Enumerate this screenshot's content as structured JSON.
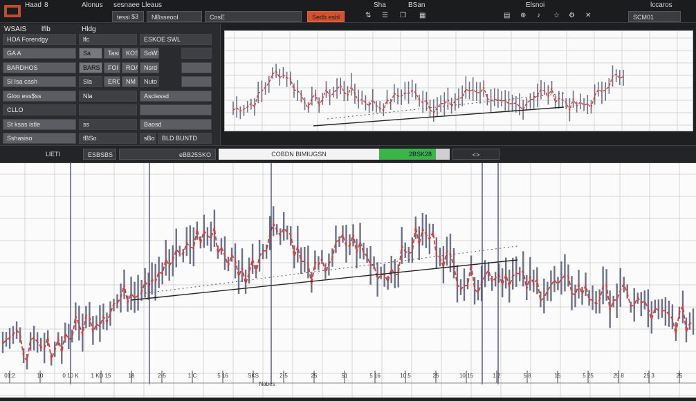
{
  "topbar": {
    "title": "Haad",
    "title_num": "8",
    "menu1": "Alonus",
    "menu2": "sesnaee Lleaus",
    "tab1": "tessi",
    "tab2": "$3",
    "tab3": "NBsseool",
    "tab4": "CosE",
    "alert_tab": "Sedb esbl",
    "right1": "Sha",
    "right2": "BSan",
    "right3": "Elsnoi",
    "right4": "SCM01",
    "far_right": "lccaros"
  },
  "panel": {
    "header_left": "WSAIS",
    "header_mid": "lflb",
    "header_right": "Hldg",
    "rows": [
      {
        "label": "HOA Forendgy",
        "c1": "lfc",
        "c2": "ESKOE SWL"
      },
      {
        "label": "GA A",
        "c1": "Sa",
        "c2": "Tasi",
        "c3": "KOS",
        "c4": "SoWSt"
      },
      {
        "label": "BARDHOS",
        "c1": "BARS",
        "c2": "FOI",
        "c3": "ROA",
        "c4": "Nsrd"
      },
      {
        "label": "Sl Isa cash",
        "c1": "Sla",
        "c2": "ERO",
        "c3": "NM",
        "c4": "Nuto"
      },
      {
        "label": "Gloo ess$ss",
        "c1": "Nla",
        "c2": "Asclassd"
      },
      {
        "label": "CLLO",
        "c1": "",
        "c2": ""
      },
      {
        "label": "St ksas istle",
        "c1": "ss",
        "c2": "Baosd"
      },
      {
        "label": "Sshasiso",
        "c1": "fBSo",
        "c2": "sBo",
        "c3": "BLD BUNTD"
      }
    ]
  },
  "statusbar": {
    "label": "LlETI",
    "field1": "ESBSBS",
    "field2": "eBB25SKO",
    "center": "COBDN BIMIUGSN",
    "green": "2BSK28",
    "nav": "<>"
  },
  "main_chart": {
    "x_label": "Nabes",
    "x_ticks": [
      "01:2",
      "10",
      "0 10 K",
      "1 KD 15",
      "18",
      "2-5",
      "1 C",
      "5 16",
      "SKS",
      "2-5",
      "25",
      "51",
      "5 16",
      "10:5",
      "25",
      "10 15",
      "1 2",
      "5 8",
      "15",
      "5 25",
      "25 8",
      "25 3",
      "25"
    ]
  },
  "colors": {
    "accent": "#d4512e",
    "candle": "#555a75",
    "trend": "#e43a32",
    "green": "#3bb54a"
  }
}
